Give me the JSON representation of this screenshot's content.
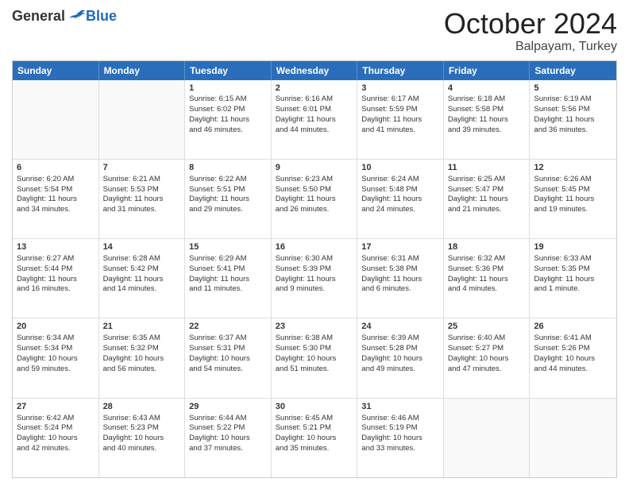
{
  "header": {
    "logo": {
      "general": "General",
      "blue": "Blue"
    },
    "title": "October 2024",
    "subtitle": "Balpayam, Turkey"
  },
  "weekdays": [
    "Sunday",
    "Monday",
    "Tuesday",
    "Wednesday",
    "Thursday",
    "Friday",
    "Saturday"
  ],
  "weeks": [
    [
      {
        "day": "",
        "empty": true
      },
      {
        "day": "",
        "empty": true
      },
      {
        "day": "1",
        "line1": "Sunrise: 6:15 AM",
        "line2": "Sunset: 6:02 PM",
        "line3": "Daylight: 11 hours",
        "line4": "and 46 minutes."
      },
      {
        "day": "2",
        "line1": "Sunrise: 6:16 AM",
        "line2": "Sunset: 6:01 PM",
        "line3": "Daylight: 11 hours",
        "line4": "and 44 minutes."
      },
      {
        "day": "3",
        "line1": "Sunrise: 6:17 AM",
        "line2": "Sunset: 5:59 PM",
        "line3": "Daylight: 11 hours",
        "line4": "and 41 minutes."
      },
      {
        "day": "4",
        "line1": "Sunrise: 6:18 AM",
        "line2": "Sunset: 5:58 PM",
        "line3": "Daylight: 11 hours",
        "line4": "and 39 minutes."
      },
      {
        "day": "5",
        "line1": "Sunrise: 6:19 AM",
        "line2": "Sunset: 5:56 PM",
        "line3": "Daylight: 11 hours",
        "line4": "and 36 minutes."
      }
    ],
    [
      {
        "day": "6",
        "line1": "Sunrise: 6:20 AM",
        "line2": "Sunset: 5:54 PM",
        "line3": "Daylight: 11 hours",
        "line4": "and 34 minutes."
      },
      {
        "day": "7",
        "line1": "Sunrise: 6:21 AM",
        "line2": "Sunset: 5:53 PM",
        "line3": "Daylight: 11 hours",
        "line4": "and 31 minutes."
      },
      {
        "day": "8",
        "line1": "Sunrise: 6:22 AM",
        "line2": "Sunset: 5:51 PM",
        "line3": "Daylight: 11 hours",
        "line4": "and 29 minutes."
      },
      {
        "day": "9",
        "line1": "Sunrise: 6:23 AM",
        "line2": "Sunset: 5:50 PM",
        "line3": "Daylight: 11 hours",
        "line4": "and 26 minutes."
      },
      {
        "day": "10",
        "line1": "Sunrise: 6:24 AM",
        "line2": "Sunset: 5:48 PM",
        "line3": "Daylight: 11 hours",
        "line4": "and 24 minutes."
      },
      {
        "day": "11",
        "line1": "Sunrise: 6:25 AM",
        "line2": "Sunset: 5:47 PM",
        "line3": "Daylight: 11 hours",
        "line4": "and 21 minutes."
      },
      {
        "day": "12",
        "line1": "Sunrise: 6:26 AM",
        "line2": "Sunset: 5:45 PM",
        "line3": "Daylight: 11 hours",
        "line4": "and 19 minutes."
      }
    ],
    [
      {
        "day": "13",
        "line1": "Sunrise: 6:27 AM",
        "line2": "Sunset: 5:44 PM",
        "line3": "Daylight: 11 hours",
        "line4": "and 16 minutes."
      },
      {
        "day": "14",
        "line1": "Sunrise: 6:28 AM",
        "line2": "Sunset: 5:42 PM",
        "line3": "Daylight: 11 hours",
        "line4": "and 14 minutes."
      },
      {
        "day": "15",
        "line1": "Sunrise: 6:29 AM",
        "line2": "Sunset: 5:41 PM",
        "line3": "Daylight: 11 hours",
        "line4": "and 11 minutes."
      },
      {
        "day": "16",
        "line1": "Sunrise: 6:30 AM",
        "line2": "Sunset: 5:39 PM",
        "line3": "Daylight: 11 hours",
        "line4": "and 9 minutes."
      },
      {
        "day": "17",
        "line1": "Sunrise: 6:31 AM",
        "line2": "Sunset: 5:38 PM",
        "line3": "Daylight: 11 hours",
        "line4": "and 6 minutes."
      },
      {
        "day": "18",
        "line1": "Sunrise: 6:32 AM",
        "line2": "Sunset: 5:36 PM",
        "line3": "Daylight: 11 hours",
        "line4": "and 4 minutes."
      },
      {
        "day": "19",
        "line1": "Sunrise: 6:33 AM",
        "line2": "Sunset: 5:35 PM",
        "line3": "Daylight: 11 hours",
        "line4": "and 1 minute."
      }
    ],
    [
      {
        "day": "20",
        "line1": "Sunrise: 6:34 AM",
        "line2": "Sunset: 5:34 PM",
        "line3": "Daylight: 10 hours",
        "line4": "and 59 minutes."
      },
      {
        "day": "21",
        "line1": "Sunrise: 6:35 AM",
        "line2": "Sunset: 5:32 PM",
        "line3": "Daylight: 10 hours",
        "line4": "and 56 minutes."
      },
      {
        "day": "22",
        "line1": "Sunrise: 6:37 AM",
        "line2": "Sunset: 5:31 PM",
        "line3": "Daylight: 10 hours",
        "line4": "and 54 minutes."
      },
      {
        "day": "23",
        "line1": "Sunrise: 6:38 AM",
        "line2": "Sunset: 5:30 PM",
        "line3": "Daylight: 10 hours",
        "line4": "and 51 minutes."
      },
      {
        "day": "24",
        "line1": "Sunrise: 6:39 AM",
        "line2": "Sunset: 5:28 PM",
        "line3": "Daylight: 10 hours",
        "line4": "and 49 minutes."
      },
      {
        "day": "25",
        "line1": "Sunrise: 6:40 AM",
        "line2": "Sunset: 5:27 PM",
        "line3": "Daylight: 10 hours",
        "line4": "and 47 minutes."
      },
      {
        "day": "26",
        "line1": "Sunrise: 6:41 AM",
        "line2": "Sunset: 5:26 PM",
        "line3": "Daylight: 10 hours",
        "line4": "and 44 minutes."
      }
    ],
    [
      {
        "day": "27",
        "line1": "Sunrise: 6:42 AM",
        "line2": "Sunset: 5:24 PM",
        "line3": "Daylight: 10 hours",
        "line4": "and 42 minutes."
      },
      {
        "day": "28",
        "line1": "Sunrise: 6:43 AM",
        "line2": "Sunset: 5:23 PM",
        "line3": "Daylight: 10 hours",
        "line4": "and 40 minutes."
      },
      {
        "day": "29",
        "line1": "Sunrise: 6:44 AM",
        "line2": "Sunset: 5:22 PM",
        "line3": "Daylight: 10 hours",
        "line4": "and 37 minutes."
      },
      {
        "day": "30",
        "line1": "Sunrise: 6:45 AM",
        "line2": "Sunset: 5:21 PM",
        "line3": "Daylight: 10 hours",
        "line4": "and 35 minutes."
      },
      {
        "day": "31",
        "line1": "Sunrise: 6:46 AM",
        "line2": "Sunset: 5:19 PM",
        "line3": "Daylight: 10 hours",
        "line4": "and 33 minutes."
      },
      {
        "day": "",
        "empty": true
      },
      {
        "day": "",
        "empty": true
      }
    ]
  ]
}
